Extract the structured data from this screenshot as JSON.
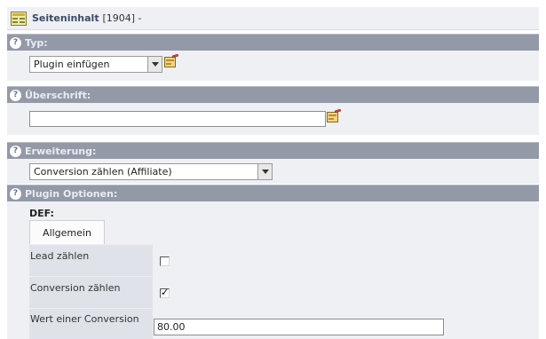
{
  "header": {
    "title": "Seiteninhalt",
    "meta": "[1904] -"
  },
  "sections": {
    "typ": {
      "label": "Typ:",
      "value": "Plugin einfügen"
    },
    "ueberschrift": {
      "label": "Überschrift:",
      "value": ""
    },
    "erweiterung": {
      "label": "Erweiterung:",
      "value": "Conversion zählen (Affiliate)"
    },
    "plugin_optionen": {
      "label": "Plugin Optionen:"
    }
  },
  "plugin": {
    "def_label": "DEF:",
    "tab_label": "Allgemein",
    "fields": {
      "lead": {
        "label": "Lead zählen",
        "checked": false
      },
      "conversion": {
        "label": "Conversion zählen",
        "checked": true
      },
      "wert": {
        "label": "Wert einer Conversion",
        "value": "80.00"
      }
    }
  },
  "help_glyph": "?",
  "colors": {
    "section_header": "#9499a8",
    "panel": "#eef0f4",
    "title_text": "#3b4a66"
  }
}
